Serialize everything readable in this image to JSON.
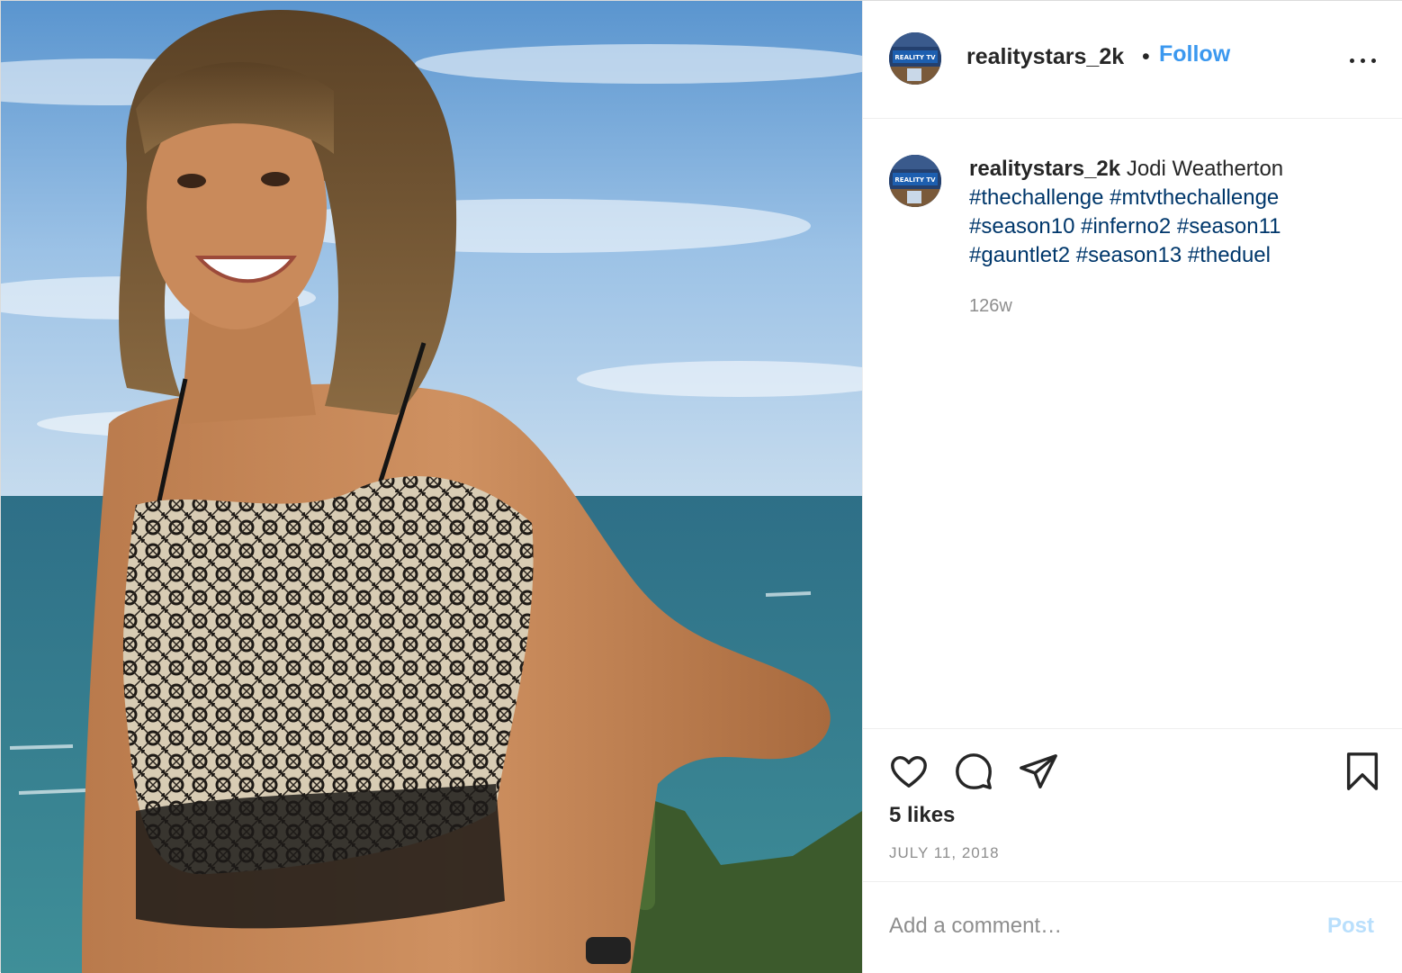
{
  "post": {
    "username": "realitystars_2k",
    "follow_label": "Follow",
    "separator": "•",
    "avatar_text": "REALITY TV",
    "caption": {
      "username": "realitystars_2k",
      "text": "Jodi Weatherton",
      "hashtags": [
        "#thechallenge",
        "#mtvthechallenge",
        "#season10",
        "#inferno2",
        "#season11",
        "#gauntlet2",
        "#season13",
        "#theduel"
      ]
    },
    "age": "126w",
    "likes": "5 likes",
    "date": "JULY 11, 2018"
  },
  "actions": {
    "icons": [
      "heart-icon",
      "comment-icon",
      "share-icon",
      "bookmark-icon",
      "more-options-icon"
    ]
  },
  "comment": {
    "placeholder": "Add a comment…",
    "post_label": "Post"
  },
  "colors": {
    "follow": "#3b98ef",
    "hashtag": "#00376b",
    "muted": "#8e8e8e",
    "post_disabled": "#b9dffc"
  }
}
